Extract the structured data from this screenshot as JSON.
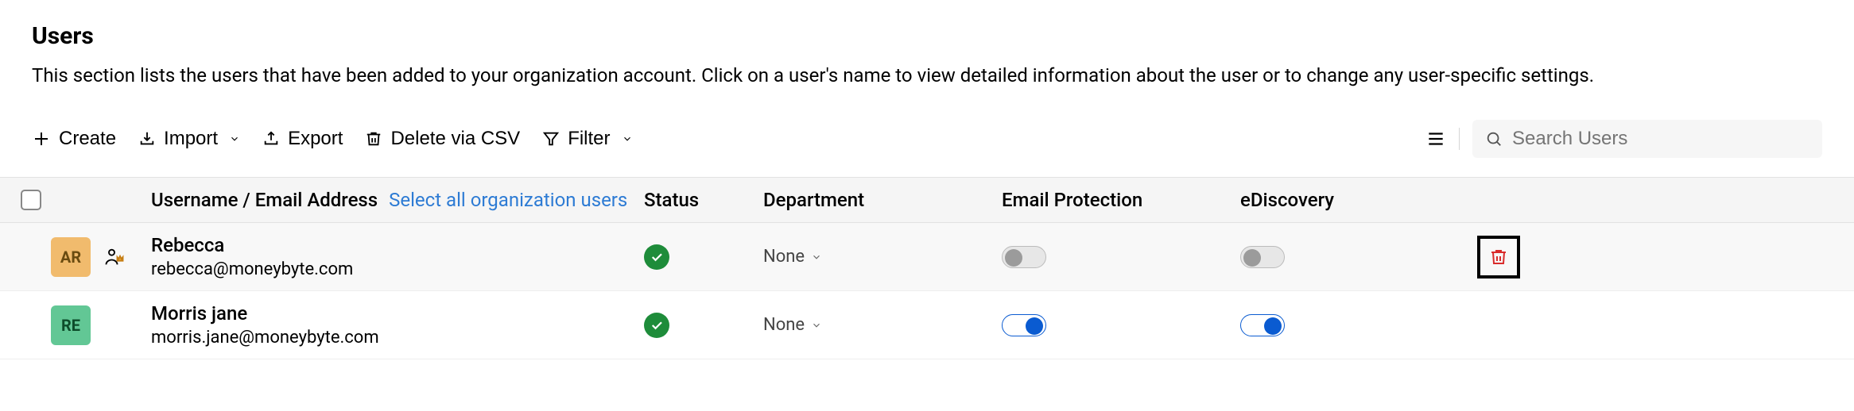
{
  "title": "Users",
  "description": "This section lists the users that have been added to your organization account. Click on a user's name to view detailed information about the user or to change any user-specific settings.",
  "toolbar": {
    "create": "Create",
    "import": "Import",
    "export": "Export",
    "deleteCsv": "Delete via CSV",
    "filter": "Filter"
  },
  "search": {
    "placeholder": "Search Users"
  },
  "columns": {
    "user": "Username / Email Address",
    "selectAll": "Select all organization users",
    "status": "Status",
    "department": "Department",
    "emailProtection": "Email Protection",
    "eDiscovery": "eDiscovery"
  },
  "rows": [
    {
      "avatarText": "AR",
      "avatarBg": "#f1bb6d",
      "avatarFg": "#6a4b10",
      "name": "Rebecca",
      "email": "rebecca@moneybyte.com",
      "statusOk": true,
      "department": "None",
      "emailProt": false,
      "eDisc": false,
      "showBadge": true,
      "showDelete": true,
      "hover": true
    },
    {
      "avatarText": "RE",
      "avatarBg": "#62c795",
      "avatarFg": "#0d4c2a",
      "name": "Morris jane",
      "email": "morris.jane@moneybyte.com",
      "statusOk": true,
      "department": "None",
      "emailProt": true,
      "eDisc": true,
      "showBadge": false,
      "showDelete": false,
      "hover": false
    }
  ]
}
